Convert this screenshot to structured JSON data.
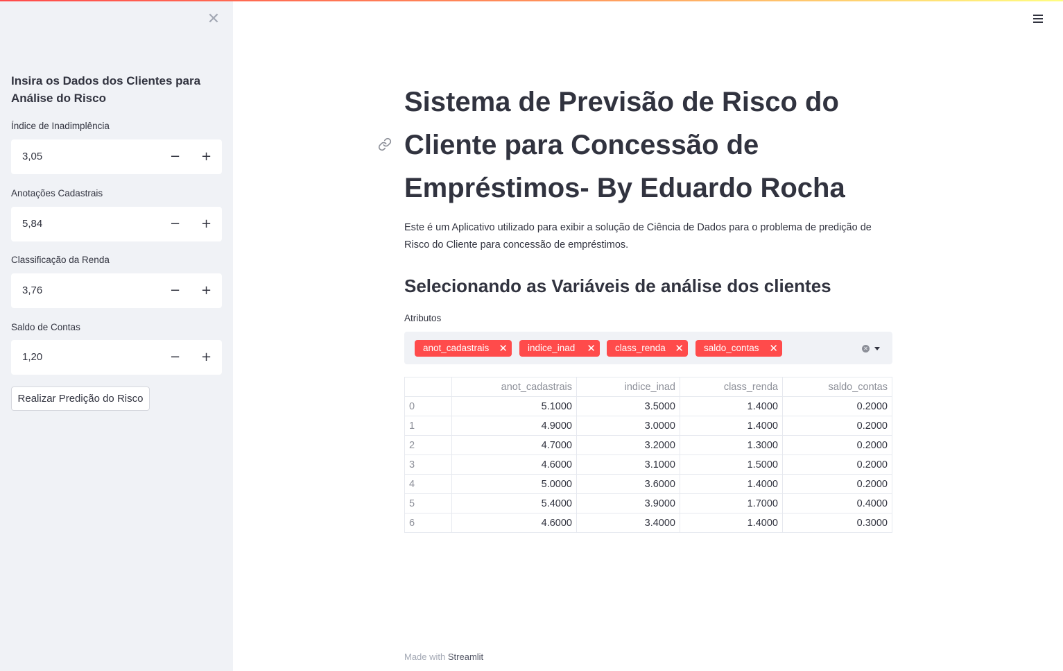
{
  "sidebar": {
    "close_glyph": "✕",
    "heading": "Insira os Dados dos Clientes para Análise do Risco",
    "fields": [
      {
        "label": "Índice de Inadimplência",
        "value": "3,05"
      },
      {
        "label": "Anotações Cadastrais",
        "value": "5,84"
      },
      {
        "label": "Classificação da Renda",
        "value": "3,76"
      },
      {
        "label": "Saldo de Contas",
        "value": "1,20"
      }
    ],
    "minus_glyph": "−",
    "plus_glyph": "+",
    "predict_button": "Realizar Predição do Risco"
  },
  "main": {
    "title": "Sistema de Previsão de Risco do Cliente para Concessão de Empréstimos- By Eduardo Rocha",
    "intro": "Este é um Aplicativo utilizado para exibir a solução de Ciência de Dados para o problema de predição de Risco do Cliente para concessão de empréstimos.",
    "subheading": "Selecionando as Variáveis de análise dos clientes",
    "multiselect": {
      "label": "Atributos",
      "tags": [
        "anot_cadastrais",
        "indice_inad",
        "class_renda",
        "saldo_contas"
      ],
      "remove_glyph": "✕",
      "clear_glyph": "✕"
    },
    "table": {
      "columns": [
        "",
        "anot_cadastrais",
        "indice_inad",
        "class_renda",
        "saldo_contas"
      ],
      "rows": [
        [
          "0",
          "5.1000",
          "3.5000",
          "1.4000",
          "0.2000"
        ],
        [
          "1",
          "4.9000",
          "3.0000",
          "1.4000",
          "0.2000"
        ],
        [
          "2",
          "4.7000",
          "3.2000",
          "1.3000",
          "0.2000"
        ],
        [
          "3",
          "4.6000",
          "3.1000",
          "1.5000",
          "0.2000"
        ],
        [
          "4",
          "5.0000",
          "3.6000",
          "1.4000",
          "0.2000"
        ],
        [
          "5",
          "5.4000",
          "3.9000",
          "1.7000",
          "0.4000"
        ],
        [
          "6",
          "4.6000",
          "3.4000",
          "1.4000",
          "0.3000"
        ]
      ]
    }
  },
  "footer": {
    "prefix": "Made with ",
    "brand": "Streamlit"
  },
  "colors": {
    "accent": "#ff4b4b",
    "sidebar_bg": "#f0f2f6",
    "text": "#31333f"
  },
  "icons": {
    "menu": "hamburger-menu-icon",
    "anchor": "link-icon",
    "close": "close-icon"
  }
}
